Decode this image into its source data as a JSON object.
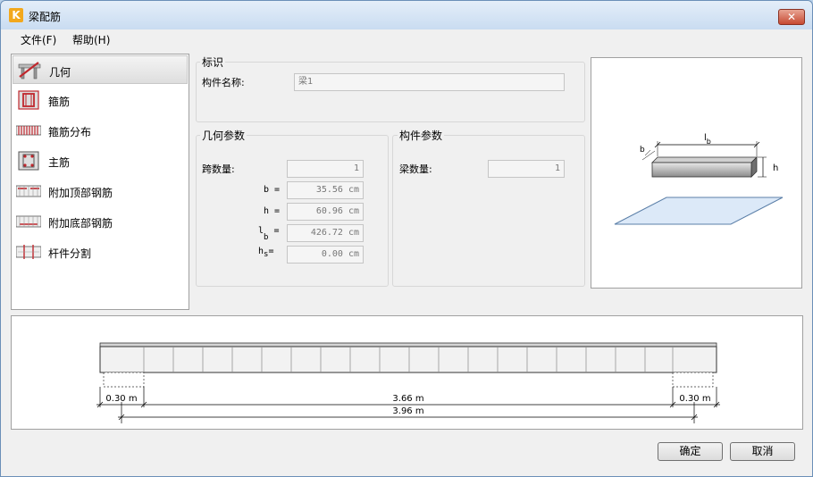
{
  "window": {
    "title": "梁配筋",
    "app_icon_letter": "K",
    "close_glyph": "✕"
  },
  "menu": {
    "file": "文件(F)",
    "help": "帮助(H)"
  },
  "nav": {
    "items": [
      {
        "label": "几何",
        "icon": "geometry-icon"
      },
      {
        "label": "箍筋",
        "icon": "stirrup-icon"
      },
      {
        "label": "箍筋分布",
        "icon": "stirrup-distribution-icon"
      },
      {
        "label": "主筋",
        "icon": "main-rebar-icon"
      },
      {
        "label": "附加顶部钢筋",
        "icon": "additional-top-rebar-icon"
      },
      {
        "label": "附加底部钢筋",
        "icon": "additional-bottom-rebar-icon"
      },
      {
        "label": "杆件分割",
        "icon": "member-split-icon"
      }
    ],
    "selected": "几何"
  },
  "identification": {
    "title": "标识",
    "name_label": "构件名称:",
    "name_value": "梁1"
  },
  "geometry_params": {
    "title": "几何参数",
    "spans_label": "跨数量:",
    "spans_value": "1",
    "b_label": "b =",
    "b_value": "35.56 cm",
    "h_label": "h =",
    "h_value": "60.96 cm",
    "lb_label_main": "l",
    "lb_label_sub": "b",
    "lb_label_eq": " =",
    "lb_value": "426.72 cm",
    "hs_label_main": "h",
    "hs_label_sub": "s",
    "hs_label_eq": "=",
    "hs_value": "0.00 cm"
  },
  "member_params": {
    "title": "构件参数",
    "count_label": "梁数量:",
    "count_value": "1"
  },
  "preview": {
    "label_lb_main": "l",
    "label_lb_sub": "b",
    "label_b": "b",
    "label_h": "h"
  },
  "elevation": {
    "left_support": "0.30 m",
    "clear_span": "3.66 m",
    "right_support": "0.30 m",
    "total": "3.96 m"
  },
  "buttons": {
    "ok": "确定",
    "cancel": "取消"
  },
  "colors": {
    "accent_red": "#c0272d",
    "slab_blue": "#dce9f8",
    "selected_bg": "#e2e2e2"
  }
}
